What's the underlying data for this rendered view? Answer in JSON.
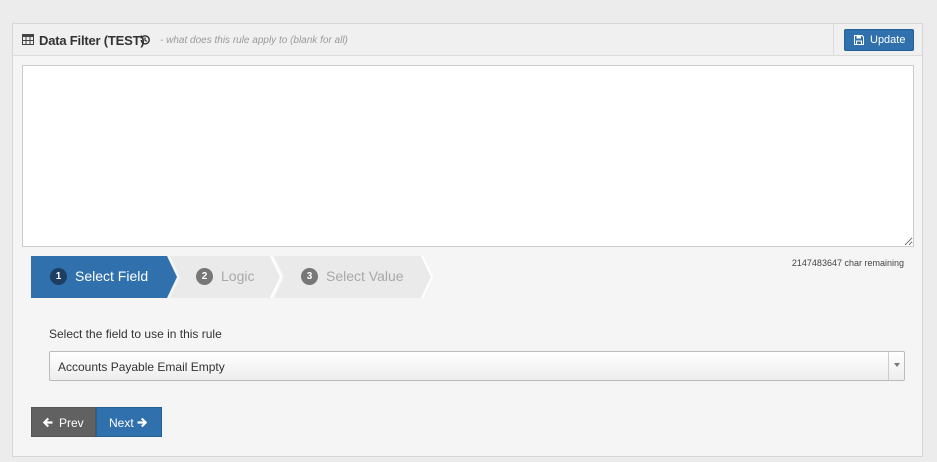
{
  "header": {
    "title": "Data Filter (TEST)",
    "hint": "- what does this rule apply to (blank for all)",
    "update_label": "Update",
    "icons": [
      "table-icon",
      "history-icon",
      "save-icon"
    ]
  },
  "description": {
    "value": "",
    "chars_remaining": "2147483647 char remaining"
  },
  "wizard": {
    "steps": [
      {
        "number": "1",
        "label": "Select Field",
        "active": true
      },
      {
        "number": "2",
        "label": "Logic",
        "active": false
      },
      {
        "number": "3",
        "label": "Select Value",
        "active": false
      }
    ]
  },
  "field_step": {
    "label": "Select the field to use in this rule",
    "selected": "Accounts Payable Email Empty"
  },
  "nav": {
    "prev_label": "Prev",
    "next_label": "Next"
  },
  "colors": {
    "primary": "#2f70ad",
    "secondary": "#616161",
    "step_inactive": "#eaeaea"
  }
}
